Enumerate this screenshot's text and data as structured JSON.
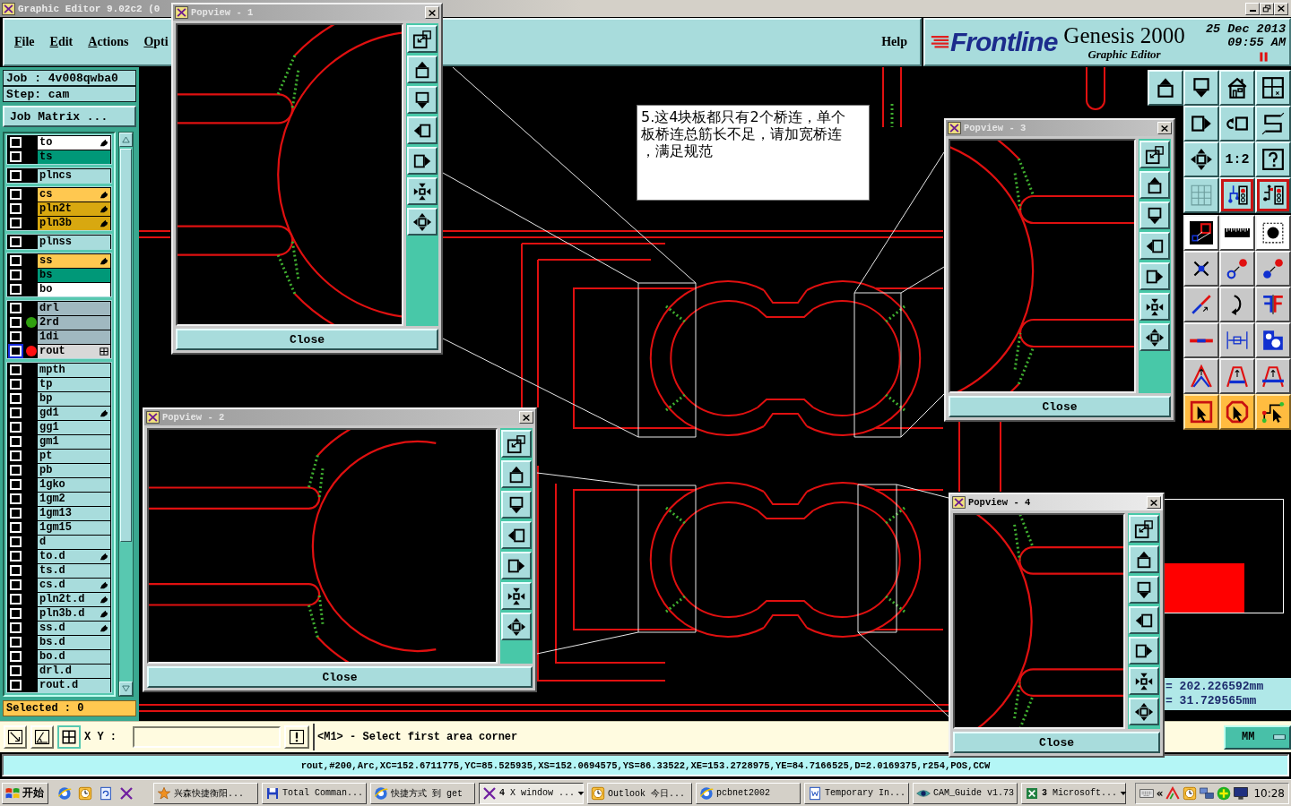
{
  "title_bar": {
    "title": "Graphic Editor 9.02c2 (0"
  },
  "menu": {
    "items": [
      "File",
      "Edit",
      "Actions",
      "Opti"
    ],
    "help": "Help"
  },
  "header": {
    "logo": "Frontline",
    "product": "Genesis 2000",
    "subtitle": "Graphic Editor",
    "date": "25 Dec 2013",
    "time": "09:55 AM"
  },
  "job_panel": {
    "job": "Job : 4v008qwba0",
    "step": "Step: cam",
    "matrix_button": "Job Matrix ...",
    "selected_count": "Selected : 0"
  },
  "layer_groups": [
    {
      "layers": [
        {
          "name": "to",
          "color": "#ffffff",
          "checked": false,
          "selected": false,
          "flagged": true
        },
        {
          "name": "ts",
          "color": "#009878",
          "checked": false,
          "selected": false,
          "flagged": false
        }
      ]
    },
    {
      "layers": [
        {
          "name": "plncs",
          "color": "#a8dcdc",
          "checked": false,
          "selected": false,
          "flagged": false
        }
      ]
    },
    {
      "layers": [
        {
          "name": "cs",
          "color": "#ffc850",
          "checked": false,
          "selected": false,
          "flagged": true
        },
        {
          "name": "pln2t",
          "color": "#d8a810",
          "checked": false,
          "selected": false,
          "flagged": true
        },
        {
          "name": "pln3b",
          "color": "#d8a810",
          "checked": false,
          "selected": false,
          "flagged": true
        }
      ]
    },
    {
      "layers": [
        {
          "name": "plnss",
          "color": "#a8dcdc",
          "checked": false,
          "selected": false,
          "flagged": false
        }
      ]
    },
    {
      "layers": [
        {
          "name": "ss",
          "color": "#ffc850",
          "checked": false,
          "selected": false,
          "flagged": true
        },
        {
          "name": "bs",
          "color": "#009878",
          "checked": false,
          "selected": false,
          "flagged": false
        },
        {
          "name": "bo",
          "color": "#ffffff",
          "checked": false,
          "selected": false,
          "flagged": false
        }
      ]
    },
    {
      "layers": [
        {
          "name": "drl",
          "color": "#a0b8c0",
          "checked": false,
          "selected": false,
          "flagged": false
        },
        {
          "name": "2rd",
          "color": "#a0b8c0",
          "checked": false,
          "selected": false,
          "flagged": false,
          "dot": {
            "color": "#30a010"
          }
        },
        {
          "name": "1di",
          "color": "#a0b8c0",
          "checked": false,
          "selected": false,
          "flagged": false
        },
        {
          "name": "rout",
          "color": "#d8d8d8",
          "checked": false,
          "selected": true,
          "flagged": false,
          "dot": {
            "color": "#ff1010"
          }
        }
      ]
    },
    {
      "layers": [
        {
          "name": "mpth",
          "color": "#a8dcdc",
          "checked": false,
          "selected": false,
          "flagged": false
        },
        {
          "name": "tp",
          "color": "#a8dcdc",
          "checked": false,
          "selected": false,
          "flagged": false
        },
        {
          "name": "bp",
          "color": "#a8dcdc",
          "checked": false,
          "selected": false,
          "flagged": false
        },
        {
          "name": "gd1",
          "color": "#a8dcdc",
          "checked": false,
          "selected": false,
          "flagged": true
        },
        {
          "name": "gg1",
          "color": "#a8dcdc",
          "checked": false,
          "selected": false,
          "flagged": false
        },
        {
          "name": "gm1",
          "color": "#a8dcdc",
          "checked": false,
          "selected": false,
          "flagged": false
        },
        {
          "name": "pt",
          "color": "#a8dcdc",
          "checked": false,
          "selected": false,
          "flagged": false
        },
        {
          "name": "pb",
          "color": "#a8dcdc",
          "checked": false,
          "selected": false,
          "flagged": false
        },
        {
          "name": "1gko",
          "color": "#a8dcdc",
          "checked": false,
          "selected": false,
          "flagged": false
        },
        {
          "name": "1gm2",
          "color": "#a8dcdc",
          "checked": false,
          "selected": false,
          "flagged": false
        },
        {
          "name": "1gm13",
          "color": "#a8dcdc",
          "checked": false,
          "selected": false,
          "flagged": false
        },
        {
          "name": "1gm15",
          "color": "#a8dcdc",
          "checked": false,
          "selected": false,
          "flagged": false
        },
        {
          "name": "d",
          "color": "#a8dcdc",
          "checked": false,
          "selected": false,
          "flagged": false
        },
        {
          "name": "to.d",
          "color": "#a8dcdc",
          "checked": false,
          "selected": false,
          "flagged": true
        },
        {
          "name": "ts.d",
          "color": "#a8dcdc",
          "checked": false,
          "selected": false,
          "flagged": false
        },
        {
          "name": "cs.d",
          "color": "#a8dcdc",
          "checked": false,
          "selected": false,
          "flagged": true
        },
        {
          "name": "pln2t.d",
          "color": "#a8dcdc",
          "checked": false,
          "selected": false,
          "flagged": true
        },
        {
          "name": "pln3b.d",
          "color": "#a8dcdc",
          "checked": false,
          "selected": false,
          "flagged": true
        },
        {
          "name": "ss.d",
          "color": "#a8dcdc",
          "checked": false,
          "selected": false,
          "flagged": true
        },
        {
          "name": "bs.d",
          "color": "#a8dcdc",
          "checked": false,
          "selected": false,
          "flagged": false
        },
        {
          "name": "bo.d",
          "color": "#a8dcdc",
          "checked": false,
          "selected": false,
          "flagged": false
        },
        {
          "name": "drl.d",
          "color": "#a8dcdc",
          "checked": false,
          "selected": false,
          "flagged": false
        },
        {
          "name": "rout.d",
          "color": "#a8dcdc",
          "checked": false,
          "selected": false,
          "flagged": false
        }
      ]
    }
  ],
  "annotation": {
    "text": "5.这4块板都只有2个桥连，单个板桥连总筋长不足，请加宽桥连，满足规范"
  },
  "popviews": [
    {
      "title": "Popview - 1",
      "active": false,
      "close_label": "Close"
    },
    {
      "title": "Popview - 2",
      "active": false,
      "close_label": "Close"
    },
    {
      "title": "Popview - 3",
      "active": false,
      "close_label": "Close"
    },
    {
      "title": "Popview - 4",
      "active": true,
      "close_label": "Close"
    }
  ],
  "right_toolbar": {
    "scale_label": "1:2",
    "net_buttons": [
      {
        "on": true
      },
      {
        "on": true
      }
    ]
  },
  "readouts": [
    "= 202.226592mm",
    "= 31.729565mm"
  ],
  "command_bar": {
    "xy_label": "X Y :",
    "prompt": "<M1> - Select first area corner",
    "units": "MM"
  },
  "status_line": "rout,#200,Arc,XC=152.6711775,YC=85.525935,XS=152.0694575,YS=86.33522,XE=153.2728975,YE=84.7166525,D=2.0169375,r254,POS,CCW",
  "taskbar": {
    "start": "开始",
    "tasks": [
      {
        "label": "兴森快捷衡阳...",
        "selected": false
      },
      {
        "label": "Total Comman...",
        "selected": false
      },
      {
        "label": "快捷方式 到 get",
        "selected": false
      },
      {
        "count": "4",
        "label": "X window ...",
        "selected": true
      },
      {
        "label": "Outlook 今日...",
        "selected": false
      },
      {
        "label": "pcbnet2002",
        "selected": false
      },
      {
        "label": "Temporary In...",
        "selected": false
      },
      {
        "label": "CAM_Guide v1.73",
        "selected": false
      },
      {
        "count": "3",
        "label": "Microsoft...",
        "selected": false
      }
    ],
    "tray_expand": "«",
    "clock": "10:28"
  }
}
